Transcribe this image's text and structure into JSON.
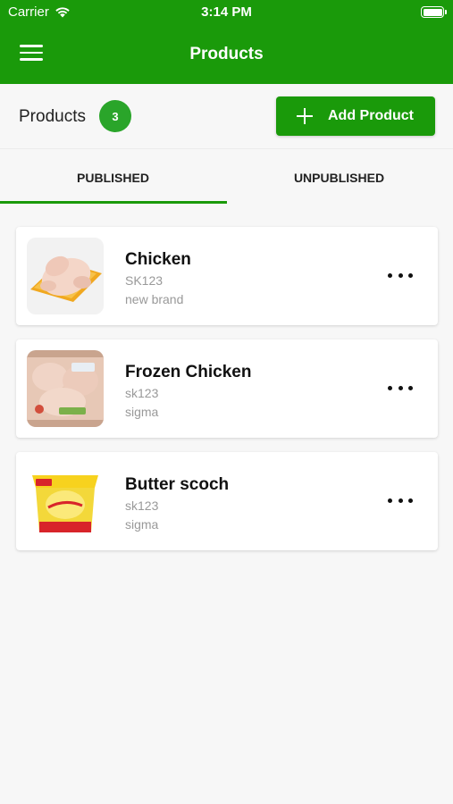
{
  "status_bar": {
    "carrier": "Carrier",
    "time": "3:14 PM"
  },
  "nav": {
    "title": "Products",
    "menu_icon": "hamburger-menu-icon"
  },
  "summary": {
    "label": "Products",
    "count": "3",
    "add_button_label": "Add Product"
  },
  "tabs": [
    {
      "label": "PUBLISHED",
      "active": true
    },
    {
      "label": "UNPUBLISHED",
      "active": false
    }
  ],
  "products": [
    {
      "name": "Chicken",
      "sku": "SK123",
      "brand": "new brand",
      "image": "raw-chicken-tray"
    },
    {
      "name": "Frozen Chicken",
      "sku": "sk123",
      "brand": "sigma",
      "image": "frozen-chicken-pack"
    },
    {
      "name": "Butter scoch",
      "sku": "sk123",
      "brand": "sigma",
      "image": "butter-tub"
    }
  ],
  "colors": {
    "brand_green": "#1a9a0a",
    "badge_green": "#2aa52a",
    "background": "#f7f7f7"
  }
}
